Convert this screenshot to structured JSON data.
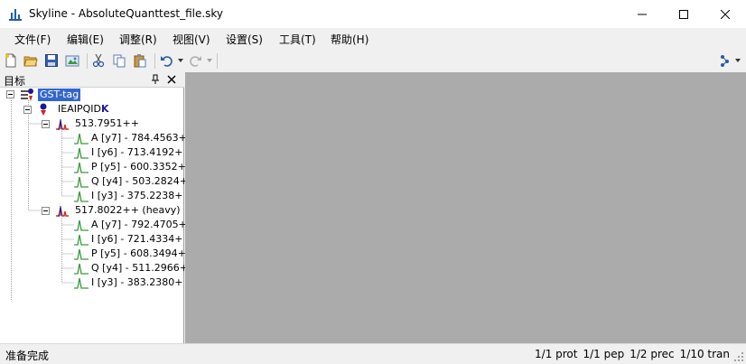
{
  "window": {
    "title": "Skyline - AbsoluteQuanttest_file.sky",
    "minimize_icon": "minimize-icon",
    "maximize_icon": "maximize-icon",
    "close_icon": "close-icon"
  },
  "menu": {
    "items": [
      "文件(F)",
      "编辑(E)",
      "调整(R)",
      "视图(V)",
      "设置(S)",
      "工具(T)",
      "帮助(H)"
    ]
  },
  "toolbar": {
    "icons": [
      "new-file-icon",
      "open-folder-icon",
      "save-icon",
      "import-icon",
      "cut-icon",
      "copy-icon",
      "paste-icon",
      "undo-icon",
      "redo-icon",
      "peptide-settings-icon"
    ]
  },
  "panel": {
    "title": "目标",
    "pin_icon": "pin-icon",
    "close_icon": "close-icon"
  },
  "tree": {
    "protein": "GST-tag",
    "peptide_prefix": "IEAIPQID",
    "peptide_heavy_residue": "K",
    "precursors": [
      {
        "label": "513.7951++",
        "transitions": [
          "A [y7] - 784.4563+",
          "I [y6] - 713.4192+",
          "P [y5] - 600.3352+",
          "Q [y4] - 503.2824+",
          "I [y3] - 375.2238+"
        ]
      },
      {
        "label": "517.8022++ (heavy)",
        "transitions": [
          "A [y7] - 792.4705+",
          "I [y6] - 721.4334+",
          "P [y5] - 608.3494+",
          "Q [y4] - 511.2966+",
          "I [y3] - 383.2380+"
        ]
      }
    ]
  },
  "status": {
    "left": "准备完成",
    "prot": "1/1 prot",
    "pep": "1/1 pep",
    "prec": "1/2 prec",
    "tran": "1/10 tran"
  },
  "colors": {
    "selection": "#3366cc",
    "peak_green": "#3a9a3a",
    "peak_red": "#d03020",
    "workspace": "#ababab",
    "heavy_k": "#1a1aa0"
  }
}
